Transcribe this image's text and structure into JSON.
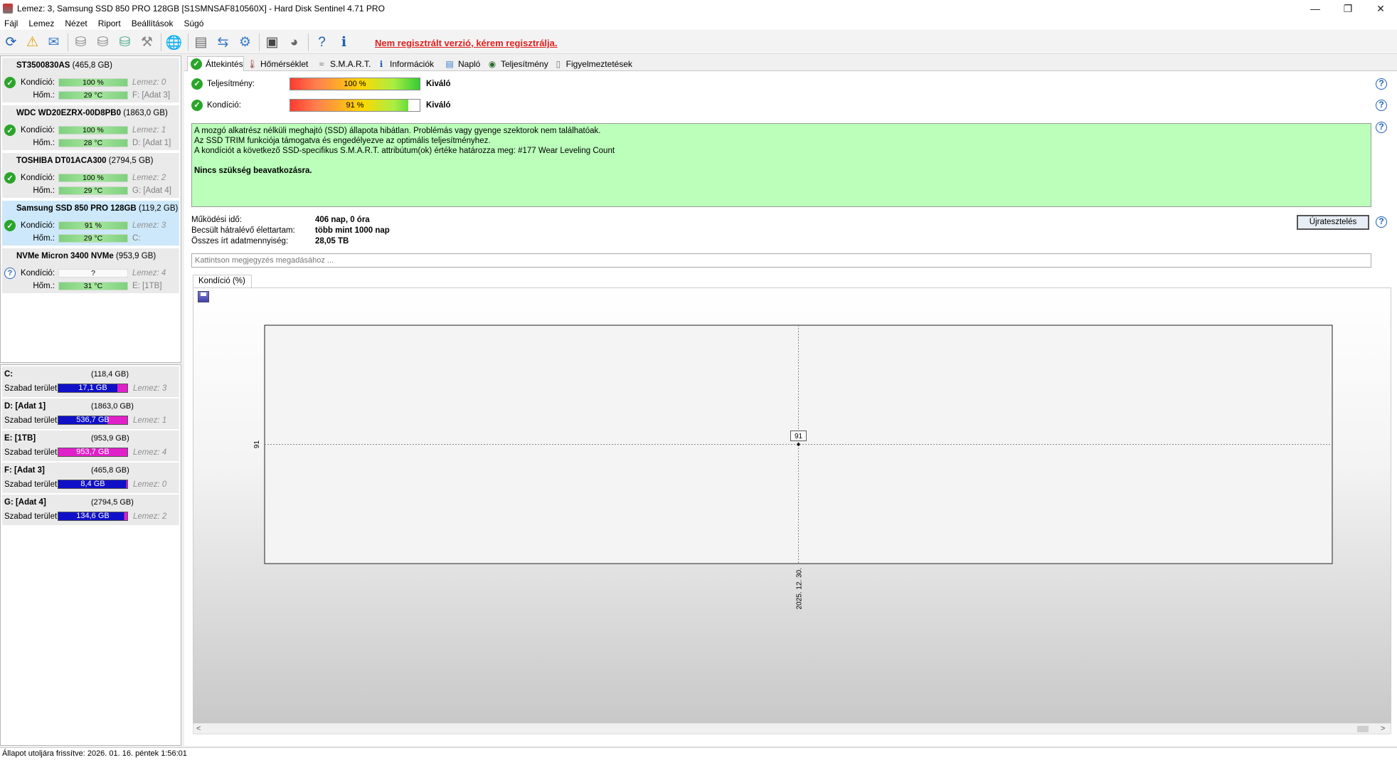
{
  "window": {
    "title": "Lemez: 3, Samsung SSD 850 PRO 128GB [S1SMNSAF810560X]  -  Hard Disk Sentinel 4.71 PRO",
    "minimize": "—",
    "maximize": "❐",
    "close": "✕"
  },
  "menu": [
    "Fájl",
    "Lemez",
    "Nézet",
    "Riport",
    "Beállítások",
    "Súgó"
  ],
  "toolbar": {
    "register_notice": "Nem regisztrált verzió, kérem regisztrálja."
  },
  "disks": [
    {
      "name": "ST3500830AS",
      "size": "(465,8 GB)",
      "status": "ok",
      "condition_label": "Kondíció:",
      "condition": "100 %",
      "condition_level": 100,
      "temp_label": "Hőm.:",
      "temp": "29 °C",
      "disk_no": "Lemez: 0",
      "volumes": "F: [Adat 3]"
    },
    {
      "name": "WDC WD20EZRX-00D8PB0",
      "size": "(1863,0 GB)",
      "status": "ok",
      "condition_label": "Kondíció:",
      "condition": "100 %",
      "condition_level": 100,
      "temp_label": "Hőm.:",
      "temp": "28 °C",
      "disk_no": "Lemez: 1",
      "volumes": "D: [Adat 1]"
    },
    {
      "name": "TOSHIBA DT01ACA300",
      "size": "(2794,5 GB)",
      "status": "ok",
      "condition_label": "Kondíció:",
      "condition": "100 %",
      "condition_level": 100,
      "temp_label": "Hőm.:",
      "temp": "29 °C",
      "disk_no": "Lemez: 2",
      "volumes": "G: [Adat 4]"
    },
    {
      "name": "Samsung SSD 850 PRO 128GB",
      "size": "(119,2 GB)",
      "status": "ok",
      "condition_label": "Kondíció:",
      "condition": "91 %",
      "condition_level": 91,
      "temp_label": "Hőm.:",
      "temp": "29 °C",
      "disk_no": "Lemez: 3",
      "volumes": "C:"
    },
    {
      "name": "NVMe    Micron 3400 NVMe",
      "size": "(953,9 GB)",
      "status": "unknown",
      "condition_label": "Kondíció:",
      "condition": "?",
      "condition_level": null,
      "temp_label": "Hőm.:",
      "temp": "31 °C",
      "disk_no": "Lemez: 4",
      "volumes": "E: [1TB]"
    }
  ],
  "volumes": [
    {
      "name": "C:",
      "size": "(118,4 GB)",
      "free_label": "Szabad terület",
      "free": "17,1 GB",
      "free_fraction": 0.144,
      "disk": "Lemez: 3"
    },
    {
      "name": "D: [Adat 1]",
      "size": "(1863,0 GB)",
      "free_label": "Szabad terület",
      "free": "536,7 GB",
      "free_fraction": 0.288,
      "disk": "Lemez: 1"
    },
    {
      "name": "E: [1TB]",
      "size": "(953,9 GB)",
      "free_label": "Szabad terület",
      "free": "953,7 GB",
      "free_fraction": 0.9998,
      "disk": "Lemez: 4"
    },
    {
      "name": "F: [Adat 3]",
      "size": "(465,8 GB)",
      "free_label": "Szabad terület",
      "free": "8,4 GB",
      "free_fraction": 0.018,
      "disk": "Lemez: 0"
    },
    {
      "name": "G: [Adat 4]",
      "size": "(2794,5 GB)",
      "free_label": "Szabad terület",
      "free": "134,6 GB",
      "free_fraction": 0.048,
      "disk": "Lemez: 2"
    }
  ],
  "tabs": [
    "Áttekintés",
    "Hőmérséklet",
    "S.M.A.R.T.",
    "Információk",
    "Napló",
    "Teljesítmény",
    "Figyelmeztetések"
  ],
  "overview": {
    "performance_label": "Teljesítmény:",
    "performance_value": "100 %",
    "performance_level": 100,
    "performance_rating": "Kiváló",
    "condition_label": "Kondíció:",
    "condition_value": "91 %",
    "condition_level": 91,
    "condition_rating": "Kiváló",
    "summary_lines": [
      "A mozgó alkatrész nélküli meghajtó (SSD) állapota hibátlan. Problémás vagy gyenge szektorok nem találhatóak.",
      "Az SSD TRIM funkciója támogatva és engedélyezve az optimális teljesítményhez.",
      "A kondíciót a következő SSD-specifikus S.M.A.R.T. attribútum(ok) értéke határozza meg:  #177 Wear Leveling Count"
    ],
    "summary_action": "Nincs szükség beavatkozásra.",
    "uptime_label": "Működési idő:",
    "uptime_value": "406 nap, 0 óra",
    "lifetime_label": "Becsült hátralévő élettartam:",
    "lifetime_value": "több mint 1000 nap",
    "written_label": "Összes írt adatmennyiség:",
    "written_value": "28,05 TB",
    "retest_button": "Újratesztelés",
    "note_placeholder": "Kattintson megjegyzés megadásához ..."
  },
  "chart_tab": "Kondíció  (%)",
  "chart_data": {
    "type": "line",
    "x": [
      "2025. 12. 30."
    ],
    "y_tick_labels": [
      "91"
    ],
    "series": [
      {
        "values": [
          91
        ]
      }
    ],
    "data_labels": [
      "91"
    ],
    "xlabel": "",
    "ylabel": "",
    "grid": true
  },
  "status_bar": "Állapot utoljára frissítve: 2026. 01. 16. péntek 1:56:01"
}
